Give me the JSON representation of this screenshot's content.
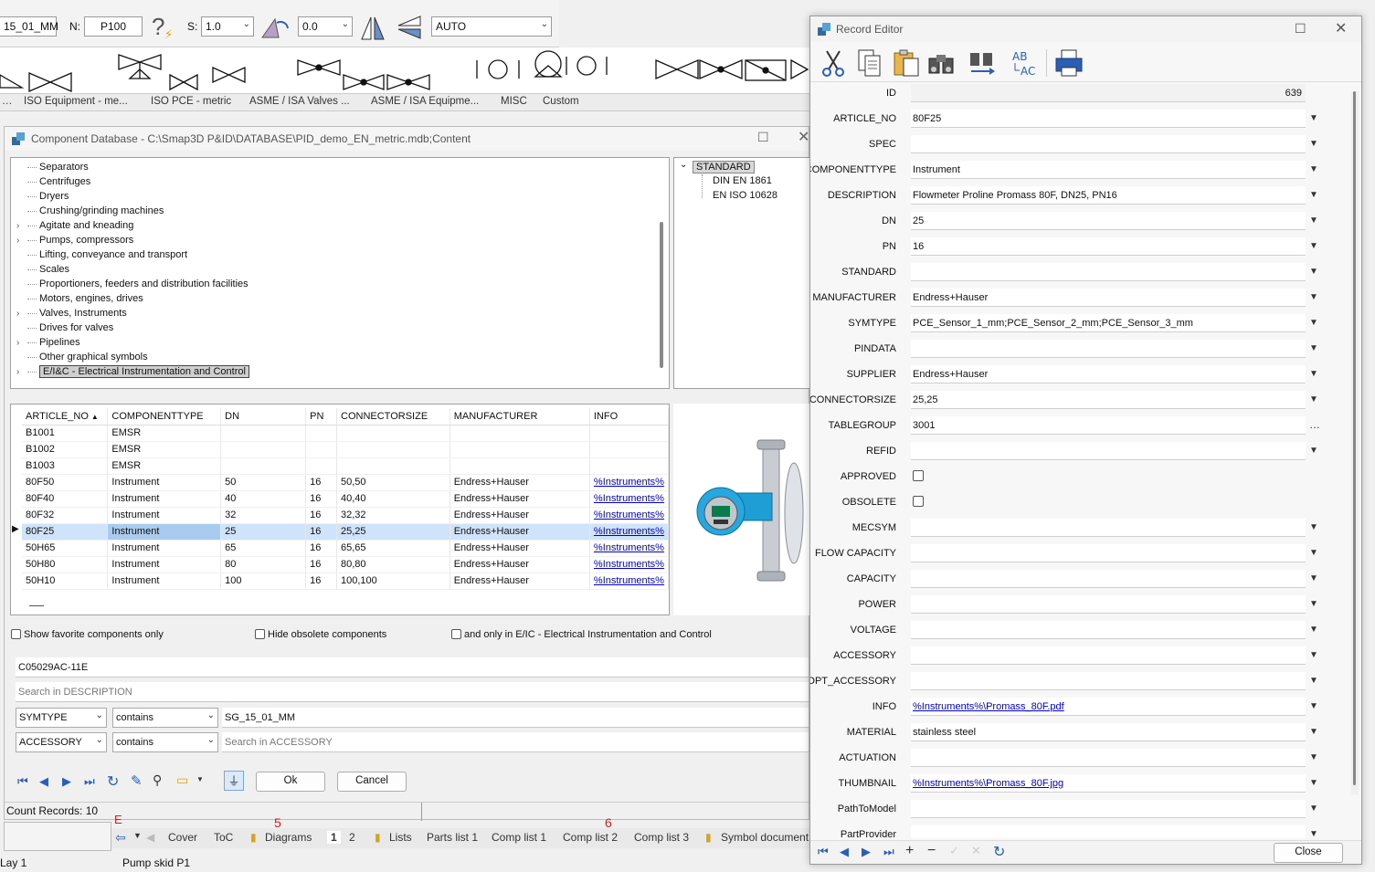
{
  "top_toolbar": {
    "symtype_field": "15_01_MM",
    "n_label": "N:",
    "n_value": "P100",
    "s_label": "S:",
    "s_value": "1.0",
    "angle_value": "0.0",
    "auto_value": "AUTO"
  },
  "symbol_tabs": [
    "ISO Equipment - me...",
    "ISO PCE - metric",
    "ASME / ISA Valves ...",
    "ASME / ISA Equipme...",
    "MISC",
    "Custom"
  ],
  "component_db": {
    "title": "Component Database - C:\\Smap3D P&ID\\DATABASE\\PID_demo_EN_metric.mdb;Content",
    "tree": [
      {
        "label": "Separators",
        "expand": false
      },
      {
        "label": "Centrifuges",
        "expand": false
      },
      {
        "label": "Dryers",
        "expand": false
      },
      {
        "label": "Crushing/grinding machines",
        "expand": false
      },
      {
        "label": "Agitate and kneading",
        "expand": true
      },
      {
        "label": "Pumps, compressors",
        "expand": true
      },
      {
        "label": "Lifting, conveyance and transport",
        "expand": false
      },
      {
        "label": "Scales",
        "expand": false
      },
      {
        "label": "Proportioners, feeders and distribution facilities",
        "expand": false
      },
      {
        "label": "Motors, engines, drives",
        "expand": false
      },
      {
        "label": "Valves, Instruments",
        "expand": true
      },
      {
        "label": "Drives for valves",
        "expand": false
      },
      {
        "label": "Pipelines",
        "expand": true
      },
      {
        "label": "Other graphical symbols",
        "expand": false
      },
      {
        "label": "E/I&C - Electrical Instrumentation and Control",
        "expand": true,
        "selected": true
      }
    ],
    "standards": {
      "root": "STANDARD",
      "children": [
        "DIN EN 1861",
        "EN ISO 10628"
      ]
    },
    "table": {
      "headers": [
        "ARTICLE_NO",
        "COMPONENTTYPE",
        "DN",
        "PN",
        "CONNECTORSIZE",
        "MANUFACTURER",
        "INFO"
      ],
      "sort_indicator": "▲",
      "rows": [
        [
          "B1001",
          "EMSR",
          "",
          "",
          "",
          "",
          ""
        ],
        [
          "B1002",
          "EMSR",
          "",
          "",
          "",
          "",
          ""
        ],
        [
          "B1003",
          "EMSR",
          "",
          "",
          "",
          "",
          ""
        ],
        [
          "80F50",
          "Instrument",
          "50",
          "16",
          "50,50",
          "Endress+Hauser",
          "%Instruments%"
        ],
        [
          "80F40",
          "Instrument",
          "40",
          "16",
          "40,40",
          "Endress+Hauser",
          "%Instruments%"
        ],
        [
          "80F32",
          "Instrument",
          "32",
          "16",
          "32,32",
          "Endress+Hauser",
          "%Instruments%"
        ],
        [
          "80F25",
          "Instrument",
          "25",
          "16",
          "25,25",
          "Endress+Hauser",
          "%Instruments%"
        ],
        [
          "50H65",
          "Instrument",
          "65",
          "16",
          "65,65",
          "Endress+Hauser",
          "%Instruments%"
        ],
        [
          "50H80",
          "Instrument",
          "80",
          "16",
          "80,80",
          "Endress+Hauser",
          "%Instruments%"
        ],
        [
          "50H10",
          "Instrument",
          "100",
          "16",
          "100,100",
          "Endress+Hauser",
          "%Instruments%"
        ]
      ],
      "selected_row": 6
    },
    "filters": {
      "favorites": "Show favorite components only",
      "obsolete": "Hide obsolete components",
      "only_in": "and only in  E/IC - Electrical Instrumentation and Control"
    },
    "search_value": "C05029AC-11E",
    "search_desc_placeholder": "Search in DESCRIPTION",
    "filter1": {
      "field": "SYMTYPE",
      "op": "contains",
      "value": "SG_15_01_MM"
    },
    "filter2": {
      "field": "ACCESSORY",
      "op": "contains",
      "placeholder": "Search in ACCESSORY"
    },
    "ok_label": "Ok",
    "cancel_label": "Cancel",
    "count_records": "Count Records: 10"
  },
  "sheet_tabs": {
    "markers": [
      "E",
      "5",
      "6"
    ],
    "tabs": [
      "Cover",
      "ToC",
      "Diagrams",
      "1",
      "2",
      "Lists",
      "Parts list 1",
      "Comp list 1",
      "Comp list 2",
      "Comp list 3",
      "Symbol document"
    ]
  },
  "statusbar": {
    "layer": "Lay 1",
    "drawing": "Pump skid P1"
  },
  "record_editor": {
    "title": "Record Editor",
    "close_label": "Close",
    "fields": [
      {
        "label": "ID",
        "value": "639",
        "type": "id"
      },
      {
        "label": "ARTICLE_NO",
        "value": "80F25",
        "type": "drop"
      },
      {
        "label": "SPEC",
        "value": "",
        "type": "drop"
      },
      {
        "label": "COMPONENTTYPE",
        "value": "Instrument",
        "type": "drop"
      },
      {
        "label": "DESCRIPTION",
        "value": "Flowmeter Proline Promass 80F, DN25, PN16",
        "type": "drop"
      },
      {
        "label": "DN",
        "value": "25",
        "type": "drop"
      },
      {
        "label": "PN",
        "value": "16",
        "type": "drop"
      },
      {
        "label": "STANDARD",
        "value": "",
        "type": "drop"
      },
      {
        "label": "MANUFACTURER",
        "value": "Endress+Hauser",
        "type": "drop"
      },
      {
        "label": "SYMTYPE",
        "value": "PCE_Sensor_1_mm;PCE_Sensor_2_mm;PCE_Sensor_3_mm",
        "type": "drop"
      },
      {
        "label": "PINDATA",
        "value": "",
        "type": "drop"
      },
      {
        "label": "SUPPLIER",
        "value": "Endress+Hauser",
        "type": "drop"
      },
      {
        "label": "CONNECTORSIZE",
        "value": "25,25",
        "type": "drop"
      },
      {
        "label": "TABLEGROUP",
        "value": "3001",
        "type": "dots"
      },
      {
        "label": "REFID",
        "value": "",
        "type": "drop"
      },
      {
        "label": "APPROVED",
        "value": "",
        "type": "check"
      },
      {
        "label": "OBSOLETE",
        "value": "",
        "type": "check"
      },
      {
        "label": "MECSYM",
        "value": "",
        "type": "drop"
      },
      {
        "label": "FLOW CAPACITY",
        "value": "",
        "type": "drop"
      },
      {
        "label": "CAPACITY",
        "value": "",
        "type": "drop"
      },
      {
        "label": "POWER",
        "value": "",
        "type": "drop"
      },
      {
        "label": "VOLTAGE",
        "value": "",
        "type": "drop"
      },
      {
        "label": "ACCESSORY",
        "value": "",
        "type": "drop"
      },
      {
        "label": "OPT_ACCESSORY",
        "value": "",
        "type": "drop"
      },
      {
        "label": "INFO",
        "value": "%Instruments%\\Promass_80F.pdf",
        "type": "link"
      },
      {
        "label": "MATERIAL",
        "value": "stainless steel",
        "type": "drop"
      },
      {
        "label": "ACTUATION",
        "value": "",
        "type": "drop"
      },
      {
        "label": "THUMBNAIL",
        "value": "%Instruments%\\Promass_80F.jpg",
        "type": "link"
      },
      {
        "label": "PathToModel",
        "value": "",
        "type": "drop"
      },
      {
        "label": "PartProvider",
        "value": "",
        "type": "drop"
      }
    ],
    "toolbar_icons": [
      "cut-icon",
      "copy-icon",
      "paste-icon",
      "find-icon",
      "find-next-icon",
      "replace-icon",
      "print-icon"
    ]
  },
  "colors": {
    "accent": "#2a5fb3",
    "selection": "#cfe3fb",
    "link": "#0000cc"
  }
}
